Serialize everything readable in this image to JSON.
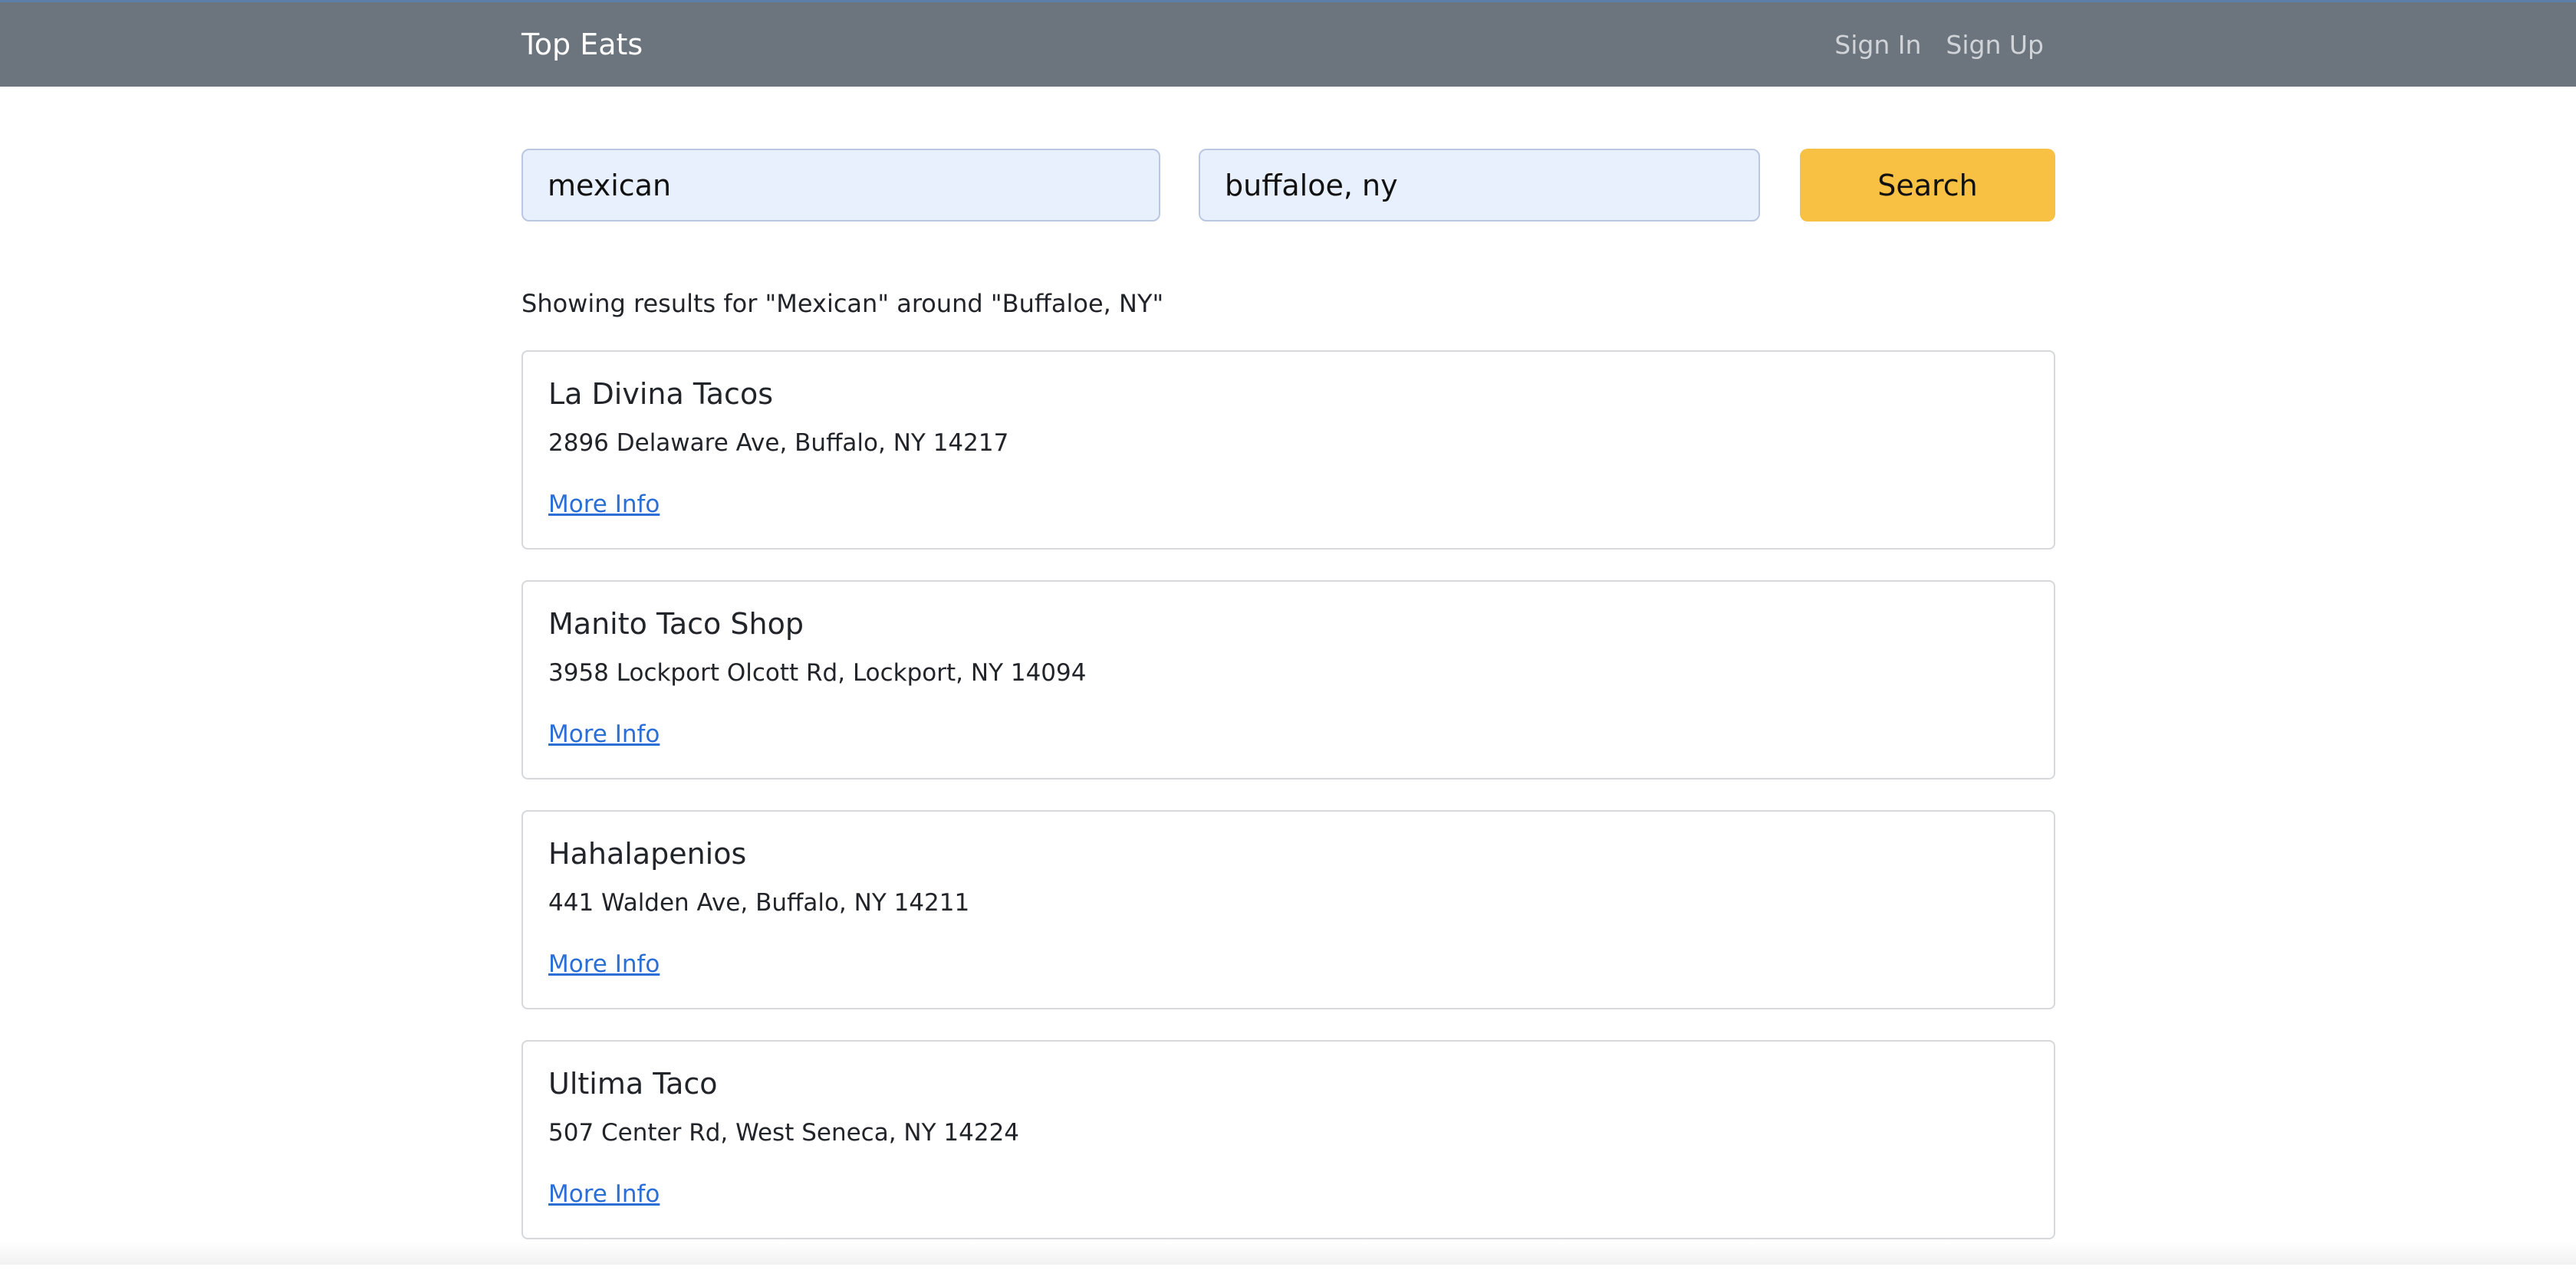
{
  "navbar": {
    "brand": "Top Eats",
    "links": [
      {
        "label": "Sign In"
      },
      {
        "label": "Sign Up"
      }
    ]
  },
  "search": {
    "term_value": "mexican",
    "location_value": "buffaloe, ny",
    "button_label": "Search"
  },
  "results": {
    "summary": "Showing results for \"Mexican\" around \"Buffaloe, NY\"",
    "items": [
      {
        "name": "La Divina Tacos",
        "address": "2896 Delaware Ave, Buffalo, NY 14217",
        "link_label": "More Info"
      },
      {
        "name": "Manito Taco Shop",
        "address": "3958 Lockport Olcott Rd, Lockport, NY 14094",
        "link_label": "More Info"
      },
      {
        "name": "Hahalapenios",
        "address": "441 Walden Ave, Buffalo, NY 14211",
        "link_label": "More Info"
      },
      {
        "name": "Ultima Taco",
        "address": "507 Center Rd, West Seneca, NY 14224",
        "link_label": "More Info"
      }
    ]
  },
  "colors": {
    "navbar_bg": "#6c757d",
    "search_button": "#f8c144",
    "input_bg": "#e8f0fe",
    "link": "#2b6fd6"
  }
}
